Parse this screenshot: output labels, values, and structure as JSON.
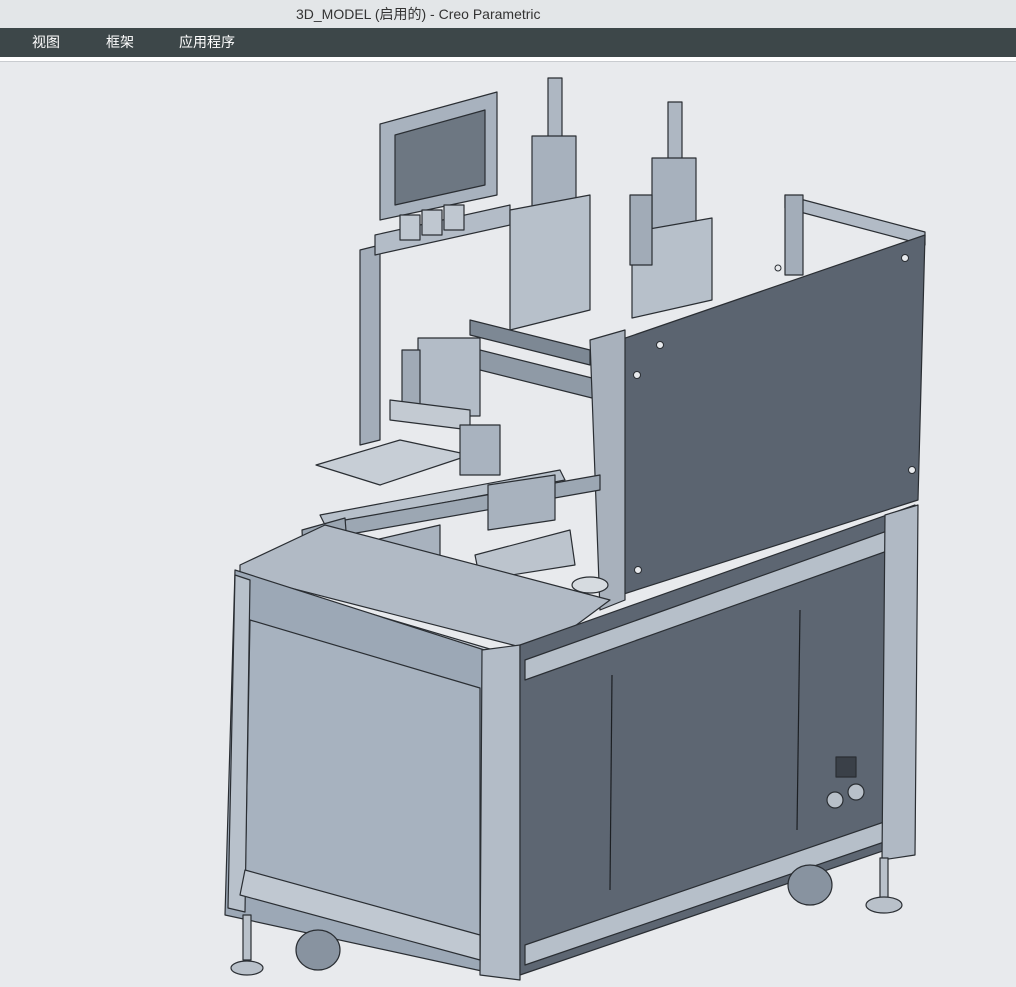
{
  "window": {
    "title": "3D_MODEL (启用的) - Creo Parametric"
  },
  "menu": {
    "items": [
      {
        "label": "视图"
      },
      {
        "label": "框架"
      },
      {
        "label": "应用程序"
      }
    ]
  },
  "viewport": {
    "background_color": "#e8eaed",
    "model_fill": "#9ea9b6",
    "model_dark": "#5c6570",
    "model_edge": "#2a2e33"
  }
}
